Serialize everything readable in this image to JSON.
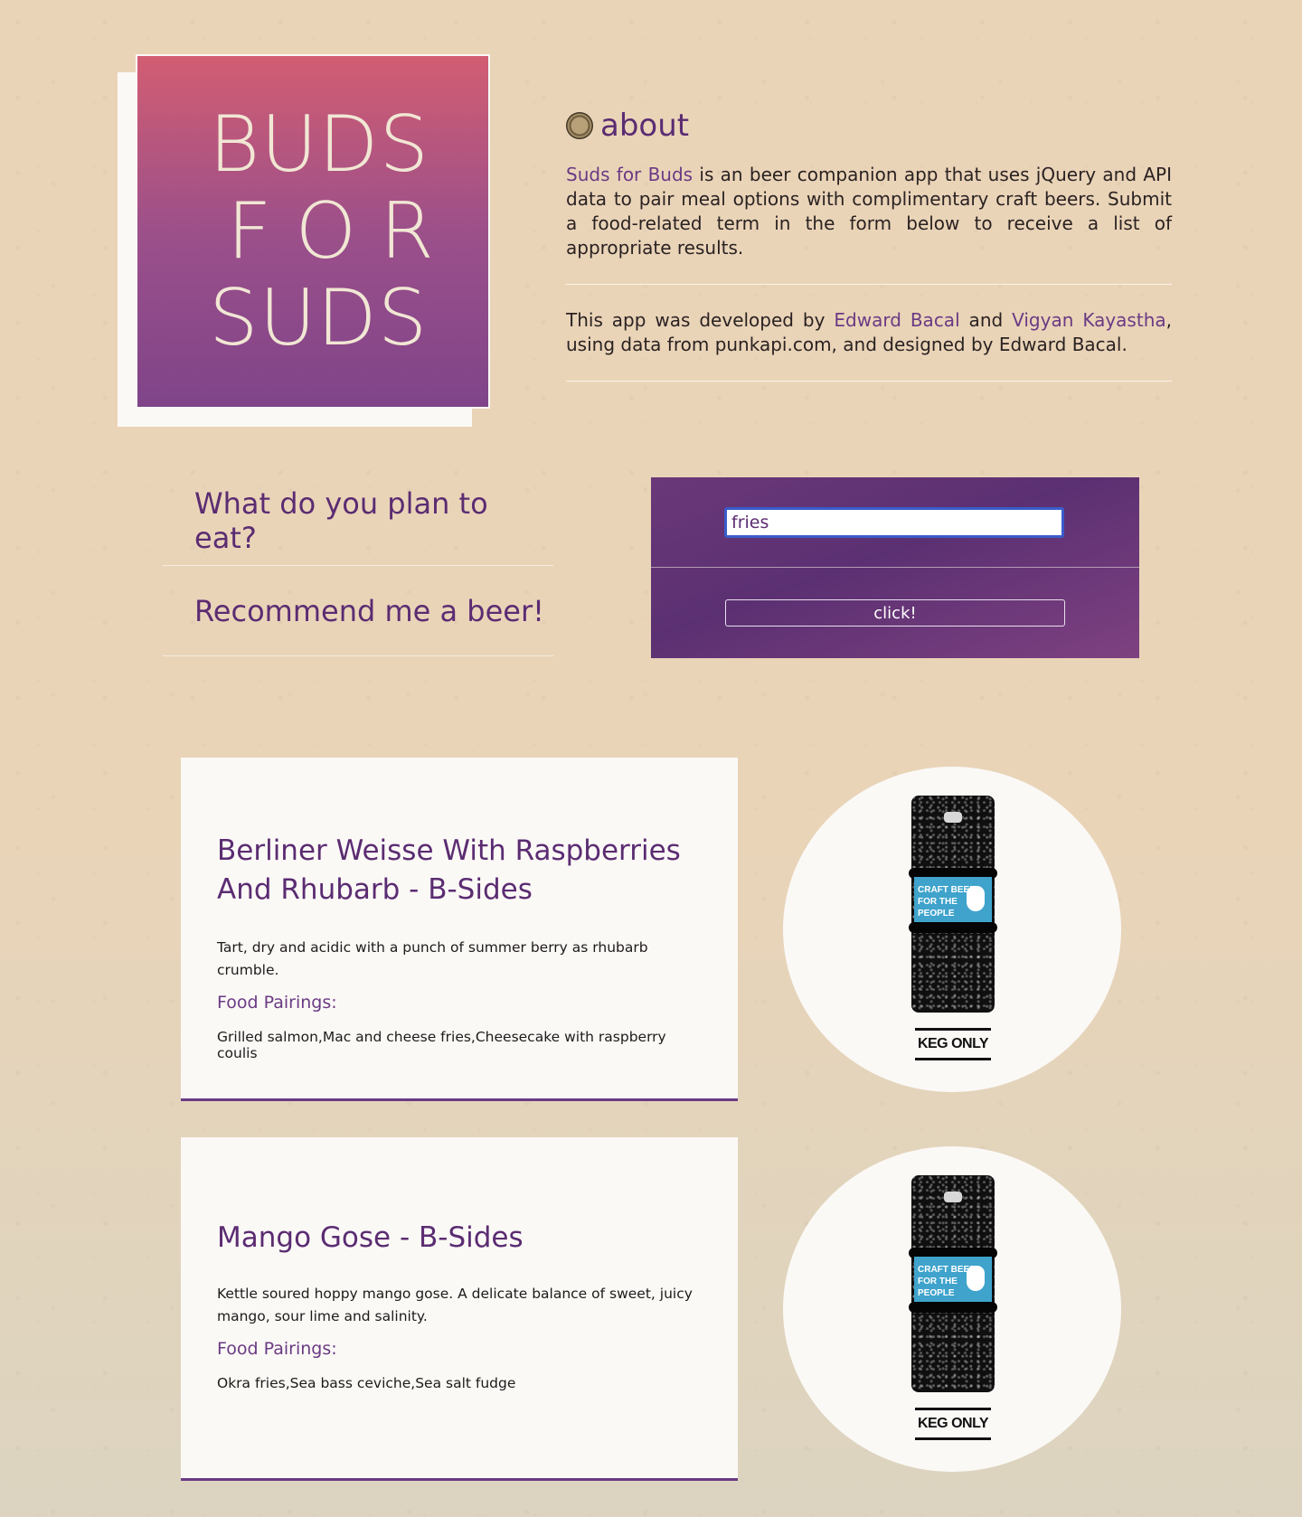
{
  "logo": {
    "line1": "BUDS",
    "line2": "FOR",
    "line3": "SUDS"
  },
  "about": {
    "icon": "bottle-cap-icon",
    "title": "about",
    "p1_link": "Suds for Buds",
    "p1_text": " is an beer companion app that uses jQuery and API data to pair meal options with complimentary craft beers. Submit a food-related term in the form below to receive a list of appropriate results.",
    "p2_text1": "This app was developed by ",
    "p2_link1": "Edward Bacal",
    "p2_text2": " and ",
    "p2_link2": "Vigyan Kayastha",
    "p2_text3": ", using data from punkapi.com, and designed by Edward Bacal."
  },
  "form": {
    "question_label": "What do you plan to eat?",
    "recommend_label": "Recommend me a beer!",
    "input_value": "fries",
    "button_label": "click!"
  },
  "results": [
    {
      "name": "Berliner Weisse With Raspberries And Rhubarb - B-Sides",
      "description": "Tart, dry and acidic with a punch of summer berry as rhubarb crumble.",
      "pairings_label": "Food Pairings:",
      "pairings": "Grilled salmon,Mac and cheese fries,Cheesecake with raspberry coulis",
      "image_label": "KEG ONLY",
      "keg_text": "CRAFT BEER FOR THE PEOPLE"
    },
    {
      "name": "Mango Gose - B-Sides",
      "description": "Kettle soured hoppy mango gose. A delicate balance of sweet, juicy mango, sour lime and salinity.",
      "pairings_label": "Food Pairings:",
      "pairings": "Okra fries,Sea bass ceviche,Sea salt fudge",
      "image_label": "KEG ONLY",
      "keg_text": "CRAFT BEER FOR THE PEOPLE"
    }
  ],
  "colors": {
    "accent_purple": "#5b2c72",
    "logo_top": "#d25d72",
    "logo_bottom": "#7f4489",
    "background": "#ead4b8"
  }
}
